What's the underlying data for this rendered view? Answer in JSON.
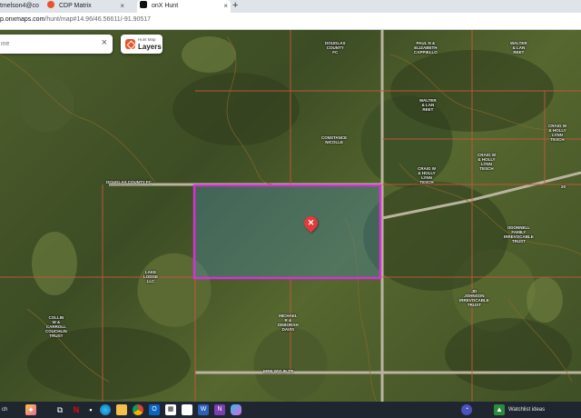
{
  "browser": {
    "tabs": [
      {
        "label": "tmelson4@co",
        "close": "×"
      },
      {
        "label": "CDP Matrix",
        "close": "×"
      },
      {
        "label": "onX Hunt",
        "close": "×"
      }
    ],
    "new_tab": "+",
    "address": {
      "host": "p.onxmaps.com",
      "path": "/hunt/map#14.96/46.56611/-91.90517"
    }
  },
  "map_controls": {
    "search": {
      "value": "",
      "placeholder": "ine",
      "clear": "×"
    },
    "layers": {
      "sublabel": "Hunt Map",
      "label": "Layers"
    }
  },
  "map": {
    "road_labels": [
      "DOUGLAS COUNTY FC",
      "ERIE WYLIE TR",
      "20"
    ],
    "parcels": [
      "DOUGLAS\nCOUNTY\nFC",
      "PAUL N &\nELIZABETH\nCAPPIELLO",
      "WALTER\n& LAN\nREET",
      "WALTER\n& LAN\nREET",
      "CRAIG W\n& HOLLY\nLYNN\nTESCH",
      "CONSTANCE\nNICOLLE",
      "CRAIG W\n& HOLLY\nLYNN\nTESCH",
      "CRAIG W\n& HOLLY\nLYNN\nTESCH",
      "ODONNELL\nFAMILY\nIRREVOCABLE\nTRUST",
      "LAKE\nLODGE\nLLC",
      "COLLIN\nW &\nCARROLL\nCOUCHLIN\nTRUST",
      "MICHAEL\nR &\nDEBORAH\nDAVIS",
      "JD\nJOHNSON\nIRREVOCABLE\nTRUST"
    ]
  },
  "taskbar": {
    "weather_label": "Watchlist ideas"
  },
  "colors": {
    "selection_outline": "#d631d6",
    "parcel_line": "#c45a3a",
    "marker": "#e23a3a",
    "layers_icon": "#e8542a"
  },
  "icons": [
    "netflix-icon",
    "edge-icon",
    "file-explorer-icon",
    "chrome-icon",
    "outlook-icon",
    "calendar-icon",
    "word-icon",
    "onenote-icon",
    "teams-icon",
    "copilot-icon",
    "widgets-icon",
    "search-icon"
  ]
}
